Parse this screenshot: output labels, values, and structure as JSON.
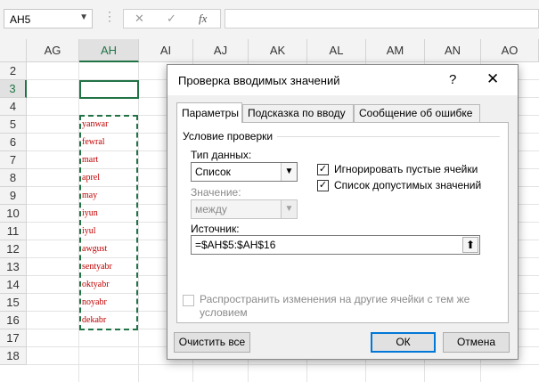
{
  "name_box": {
    "value": "AH5"
  },
  "formula_bar": {
    "cancel_glyph": "✕",
    "enter_glyph": "✓",
    "fx_glyph": "fx",
    "value": ""
  },
  "columns": [
    "AG",
    "AH",
    "AI",
    "AJ",
    "AK",
    "AL",
    "AM",
    "AN",
    "AO"
  ],
  "rows": [
    "2",
    "3",
    "4",
    "5",
    "6",
    "7",
    "8",
    "9",
    "10",
    "11",
    "12",
    "13",
    "14",
    "15",
    "16",
    "17",
    "18"
  ],
  "cells_ah": [
    "yanwar",
    "fewral",
    "mart",
    "aprel",
    "may",
    "iyun",
    "iyul",
    "awgust",
    "sentyabr",
    "oktyabr",
    "noyabr",
    "dekabr"
  ],
  "colors": {
    "accent": "#217346",
    "cell_text": "#c00000",
    "default_border": "#0078d7"
  },
  "dialog": {
    "title": "Проверка вводимых значений",
    "help": "?",
    "close": "✕",
    "tabs": [
      "Параметры",
      "Подсказка по вводу",
      "Сообщение об ошибке"
    ],
    "group_label": "Условие проверки",
    "data_type_label": "Тип данных:",
    "data_type_value": "Список",
    "value_label": "Значение:",
    "value_value": "между",
    "ignore_blank_label": "Игнорировать пустые ячейки",
    "ignore_blank_checked": "✓",
    "in_cell_dropdown_label": "Список допустимых значений",
    "in_cell_dropdown_checked": "✓",
    "source_label": "Источник:",
    "source_value": "=$AH$5:$AH$16",
    "apply_label_line1": "Распространить изменения на другие ячейки с тем же",
    "apply_label_line2": "условием",
    "clear_all": "Очистить все",
    "ok": "ОК",
    "cancel": "Отмена"
  }
}
